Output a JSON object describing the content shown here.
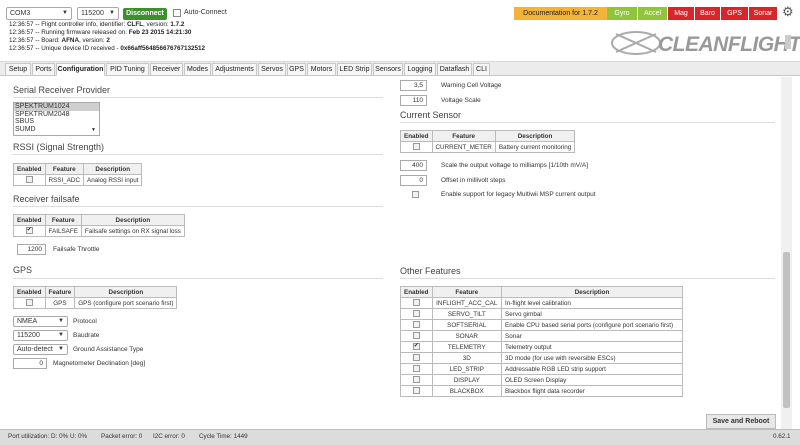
{
  "header": {
    "port": "COM3",
    "baud": "115200",
    "disconnect_label": "Disconnect",
    "auto_connect_label": "Auto-Connect",
    "documentation_label": "Documentation for 1.7.2",
    "sensors": [
      {
        "label": "Gyro",
        "color": "#8fc43b"
      },
      {
        "label": "Accel",
        "color": "#8fc43b"
      },
      {
        "label": "Mag",
        "color": "#d7262b"
      },
      {
        "label": "Baro",
        "color": "#d7262b"
      },
      {
        "label": "GPS",
        "color": "#d7262b"
      },
      {
        "label": "Sonar",
        "color": "#d7262b"
      }
    ],
    "settings_icon": "gear-icon",
    "log": [
      {
        "prefix": "12:36:57 -- Flight controller info, identifier: ",
        "value": "CLFL",
        "mid": ", version: ",
        "value2": "1.7.2"
      },
      {
        "prefix": "12:36:57 -- Running firmware released on: ",
        "value": "Feb 23 2015 14:21:30",
        "mid": "",
        "value2": ""
      },
      {
        "prefix": "12:36:57 -- Board: ",
        "value": "AFNA",
        "mid": ", version: ",
        "value2": "2"
      },
      {
        "prefix": "12:36:57 -- Unique device ID received - ",
        "value": "0x66aff564856676767132512",
        "mid": "",
        "value2": ""
      }
    ],
    "logo_text": "CLEANFLIGHT"
  },
  "tabs": [
    "Setup",
    "Ports",
    "Configuration",
    "PID Tuning",
    "Receiver",
    "Modes",
    "Adjustments",
    "Servos",
    "GPS",
    "Motors",
    "LED Strip",
    "Sensors",
    "Logging",
    "Dataflash",
    "CLI"
  ],
  "active_tab": "Configuration",
  "left": {
    "serial_rx_title": "Serial Receiver Provider",
    "serial_rx_options": [
      "SPEKTRUM1024",
      "SPEKTRUM2048",
      "SBUS",
      "SUMD"
    ],
    "rssi_title": "RSSI (Signal Strength)",
    "table_headers": [
      "Enabled",
      "Feature",
      "Description"
    ],
    "rssi_rows": [
      {
        "checked": false,
        "feature": "RSSI_ADC",
        "description": "Analog RSSI input"
      }
    ],
    "failsafe_title": "Receiver failsafe",
    "failsafe_rows": [
      {
        "checked": true,
        "feature": "FAILSAFE",
        "description": "Failsafe settings on RX signal loss"
      }
    ],
    "failsafe_throttle_value": "1200",
    "failsafe_throttle_label": "Failsafe Throttle",
    "gps_title": "GPS",
    "gps_rows": [
      {
        "checked": false,
        "feature": "GPS",
        "description": "GPS (configure port scenario first)"
      }
    ],
    "protocol_value": "NMEA",
    "protocol_label": "Protocol",
    "baudrate_value": "115200",
    "baudrate_label": "Baudrate",
    "ground_value": "Auto-detect",
    "ground_label": "Ground Assistance Type",
    "mag_dec_value": "0",
    "mag_dec_label": "Magnetometer Declination [deg]"
  },
  "right": {
    "warning_cell_value": "3,5",
    "warning_cell_label": "Warning Cell Voltage",
    "voltage_scale_value": "110",
    "voltage_scale_label": "Voltage Scale",
    "current_title": "Current Sensor",
    "table_headers": [
      "Enabled",
      "Feature",
      "Description"
    ],
    "current_rows": [
      {
        "checked": false,
        "feature": "CURRENT_METER",
        "description": "Battery current monitoring"
      }
    ],
    "scale_value": "400",
    "scale_label": "Scale the output voltage to milliamps [1/10th mV/A]",
    "offset_value": "0",
    "offset_label": "Offset in millivolt steps",
    "legacy_label": "Enable support for legacy Multiwii MSP current output",
    "other_title": "Other Features",
    "other_rows": [
      {
        "checked": false,
        "feature": "INFLIGHT_ACC_CAL",
        "description": "In-flight level calibration"
      },
      {
        "checked": false,
        "feature": "SERVO_TILT",
        "description": "Servo gimbal"
      },
      {
        "checked": false,
        "feature": "SOFTSERIAL",
        "description": "Enable CPU based serial ports (configure port scenario first)"
      },
      {
        "checked": false,
        "feature": "SONAR",
        "description": "Sonar"
      },
      {
        "checked": true,
        "feature": "TELEMETRY",
        "description": "Telemetry output"
      },
      {
        "checked": false,
        "feature": "3D",
        "description": "3D mode (for use with reversible ESCs)"
      },
      {
        "checked": false,
        "feature": "LED_STRIP",
        "description": "Addressable RGB LED strip support"
      },
      {
        "checked": false,
        "feature": "DISPLAY",
        "description": "OLED Screen Display"
      },
      {
        "checked": false,
        "feature": "BLACKBOX",
        "description": "Blackbox flight data recorder"
      }
    ],
    "save_label": "Save and Reboot"
  },
  "status": {
    "port_util": "Port utilization: D: 0% U: 0%",
    "packet_error": "Packet error: 0",
    "i2c_error": "I2C error: 0",
    "cycle_time": "Cycle Time: 1449",
    "version": "0.62.1"
  }
}
